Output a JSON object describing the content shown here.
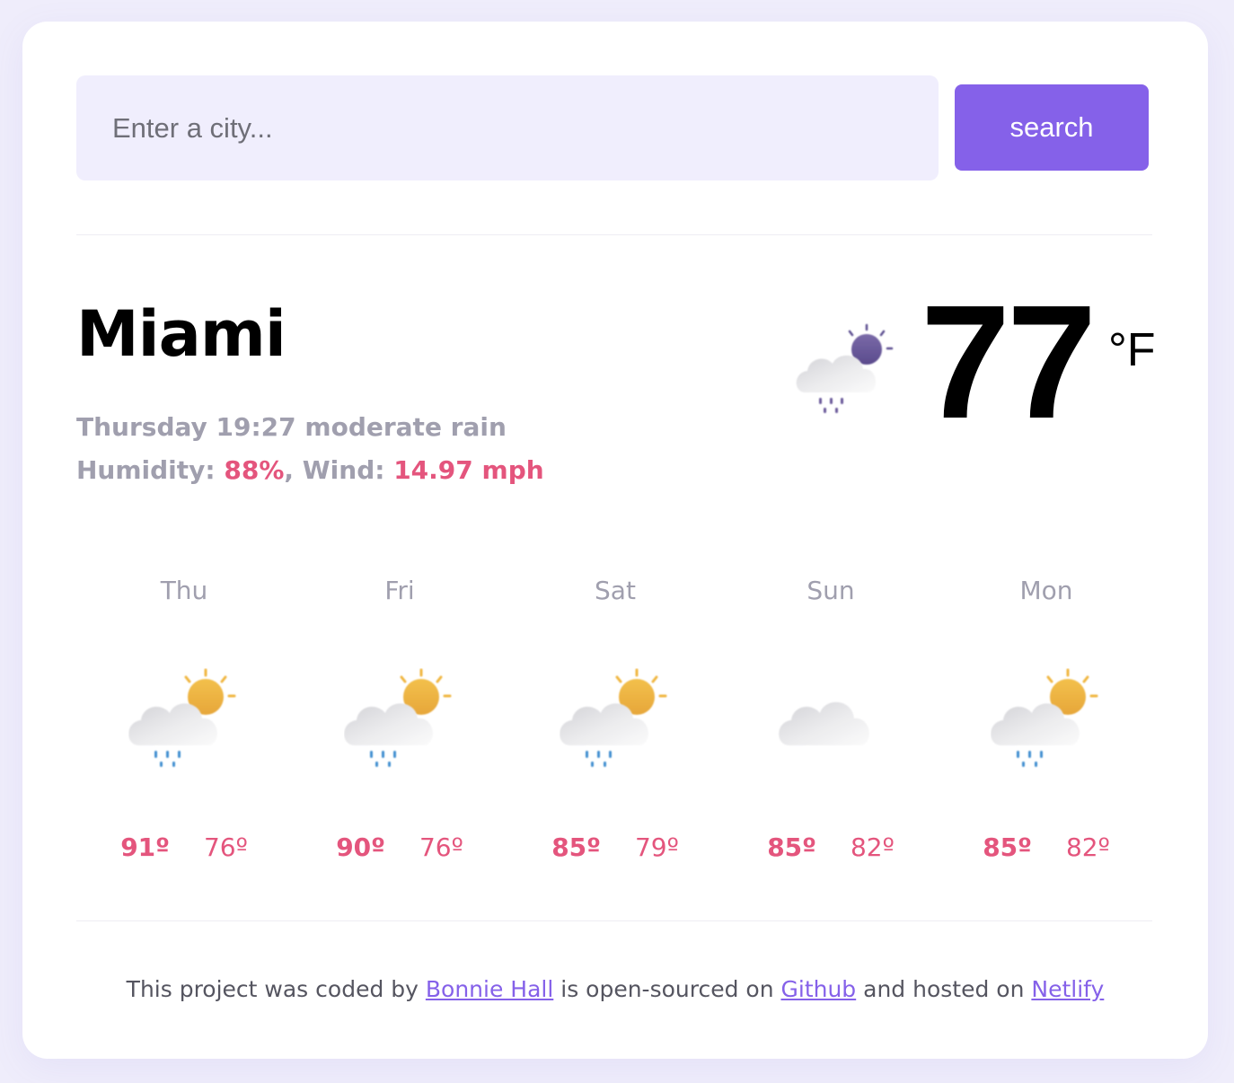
{
  "search": {
    "placeholder": "Enter a city...",
    "button_label": "search"
  },
  "current": {
    "city": "Miami",
    "day_time": "Thursday 19:27",
    "description": "moderate rain",
    "humidity_label": "Humidity: ",
    "humidity_value": "88%",
    "wind_label": ", Wind: ",
    "wind_value": "14.97 mph",
    "temperature": "77",
    "unit": "°F",
    "icon": "rain-night-icon"
  },
  "forecast": [
    {
      "day": "Thu",
      "max": "91º",
      "min": "76º",
      "icon": "rain-sun-icon"
    },
    {
      "day": "Fri",
      "max": "90º",
      "min": "76º",
      "icon": "rain-sun-icon"
    },
    {
      "day": "Sat",
      "max": "85º",
      "min": "79º",
      "icon": "rain-sun-icon"
    },
    {
      "day": "Sun",
      "max": "85º",
      "min": "82º",
      "icon": "cloud-icon"
    },
    {
      "day": "Mon",
      "max": "85º",
      "min": "82º",
      "icon": "rain-sun-icon"
    }
  ],
  "footer": {
    "text_1": "This project was coded by ",
    "author_link": "Bonnie Hall",
    "text_2": " is open-sourced on ",
    "github_link": "Github",
    "text_3": " and hosted on ",
    "netlify_link": "Netlify"
  },
  "colors": {
    "accent": "#8561e9",
    "highlight": "#e4557d",
    "muted": "#a09fae",
    "input_bg": "#f0eefd",
    "page_bg": "#efedfb"
  }
}
